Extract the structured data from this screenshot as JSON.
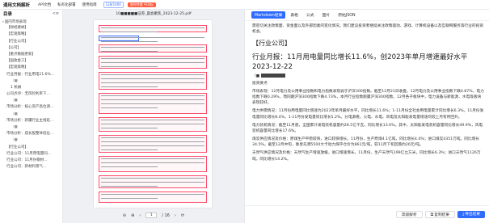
{
  "header": {
    "logo": "通用文档解析",
    "nav": [
      "API文档",
      "私有化部署",
      "使用指南"
    ],
    "quota": "128/1000",
    "promo": "限时特惠 ¥18起"
  },
  "sidebar": {
    "title": "目录",
    "items": [
      {
        "label": "国内市场表现",
        "level": 0,
        "caret": "▾"
      },
      {
        "label": "【财经要闻】",
        "level": 1
      },
      {
        "label": "【宏观策略】",
        "level": 1
      },
      {
        "label": "【行业公司】",
        "level": 1
      },
      {
        "label": "【公司】",
        "level": 1
      },
      {
        "label": "【重点数据更新】",
        "level": 1
      },
      {
        "label": "【固收金工】",
        "level": 1
      },
      {
        "label": "【宏观策略】",
        "level": 1
      },
      {
        "label": "行业月报：行业用电11.6%...",
        "level": 1
      },
      {
        "label": "（■",
        "level": 2,
        "muted": true
      },
      {
        "label": "1 机械",
        "level": 2
      },
      {
        "label": "公司点评：无风险利率下...",
        "level": 1
      },
      {
        "label": "（■",
        "level": 2,
        "muted": true
      },
      {
        "label": "市场分析：核心资产高位调...",
        "level": 1
      },
      {
        "label": "（■",
        "level": 2,
        "muted": true
      },
      {
        "label": "市场分析：新疆行业主线延...",
        "level": 1
      },
      {
        "label": "（■",
        "level": 2,
        "muted": true
      },
      {
        "label": "市场分析：成长股整体低位...",
        "level": 1
      },
      {
        "label": "（■",
        "level": 2,
        "muted": true
      },
      {
        "label": "【行业公司】",
        "level": 1
      },
      {
        "label": "行业公司：11月用电量同...",
        "level": 1
      },
      {
        "label": "行业公司：11月份钢材...",
        "level": 1
      },
      {
        "label": "行业公司：新材料景气...",
        "level": 1
      }
    ]
  },
  "viewer": {
    "filename": "10■■■■■证券_晨会聚焦_2023-12-25.pdf",
    "page_current": "1",
    "page_total": "/ 16",
    "zoom_label": "100%"
  },
  "right": {
    "tabs": [
      "Markdown结果",
      "表格",
      "公式",
      "图片",
      "原始JSON"
    ],
    "active_tab": 0,
    "intro": "需密切关注政策面、资金面以及外部因素的变化情况。我们建议投资者继续关注政策驱动、游戏、计算机设备以及互联网服务等行业的投资机会。",
    "section": "【行业公司】",
    "title": "行业月报：11月用电量同比增长11.6%，创2023年单月增速最好水平 2023-12-22",
    "author_prefix": "（■",
    "author_note": "投资要点",
    "paragraphs": [
      "市场表现：12月电力及公用事业指数和电力指数表现弱于沪深300指数。截至12月21日收盘，12月电力及公用事业指数下跌0.87%，电力指数下跌0.29%，而同期沪深300指数下跌4.73%，本月行业指数跑赢沪深300指数。12月各子板块中，电力设备与新能源、水电等板块表现较好。",
      "电力供需情况：11月份用电量同比增速为2023年单月最好水平，同比增长11.6%；1-11月份全社会用电量累计同比增长6.3%。11月份发电量同比增长8.4%，1-11月份发电量同比增长5.2%。分电源看，火电、水电、风电及太阳能发电量增速均较上月有所回升。",
      "电力装机情况：截至11月底，全国累计发电装机容量约28.5亿千瓦，同比增长13.6%。其中，太阳能发电装机容量同比增长49.9%，风电装机容量同比增长17.6%。",
      "煤炭供应情况及价格：原煤生产平稳较快，进口较快增长。11月份，生产原煤4.1亿吨，同比增长4.4%；进口煤炭4351万吨，同比增长34.5%。截至12月中旬，秦皇岛港5500大卡动力煤平仓价为861元/吨，较11月下旬回落约26元/吨。",
      "天然气供应情况及价格：天然气生产增速放缓，进口增速增长。11月份，生产天然气199亿立方米，同比增长6.3%；进口天然气1126万吨，同比增长14.2%。"
    ],
    "buttons": {
      "compare": "高级解析",
      "copy": "复制结果",
      "export": "导出结果"
    }
  },
  "colors": {
    "accent": "#2f6bff",
    "highlight": "#ff4d6d",
    "promo": "#ff5a3c"
  }
}
